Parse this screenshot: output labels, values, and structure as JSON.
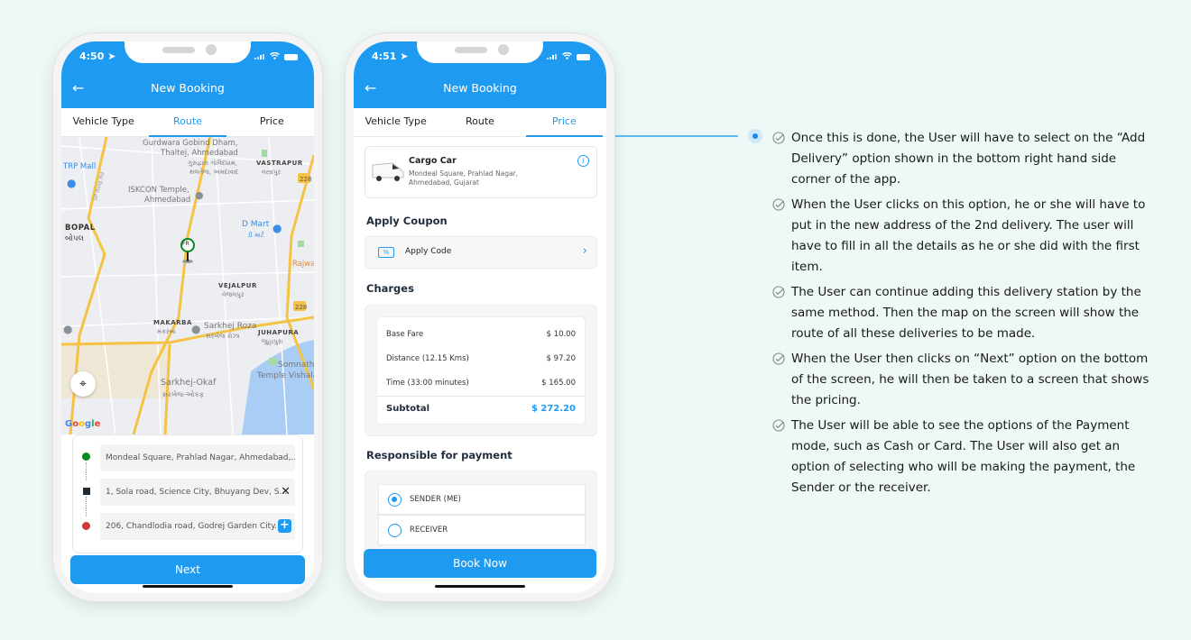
{
  "phone_route": {
    "status_time": "4:50",
    "header_title": "New Booking",
    "tabs": [
      {
        "label": "Vehicle Type",
        "active": false
      },
      {
        "label": "Route",
        "active": true
      },
      {
        "label": "Price",
        "active": false
      }
    ],
    "map": {
      "labels": {
        "gurdwara": "Gurdwara Gobind Dham,",
        "thaltej": "Thaltej, Ahmedabad",
        "gurdwara_gu": "ગુરુદ્વારા ગોવિંદધામ,",
        "thaltej_gu": "થલતેજ, અમદાવાદ",
        "trp": "TRP Mall",
        "vastrapur": "VASTRAPUR",
        "vastrapur_gu": "વસ્ત્રાપુર",
        "iskcon": "ISKCON Temple,",
        "iskcon2": "Ahmedabad",
        "bopal": "BOPAL",
        "bopal_gu": "બોપલ",
        "dmart": "D Mart",
        "dmart_gu": "ડી માર્ટ",
        "rajwa": "Rajwa",
        "vejalpur": "VEJALPUR",
        "vejalpur_gu": "વેજલપુર",
        "makarba": "MAKARBA",
        "makarba_gu": "મકરબા",
        "sarkhej_roza": "Sarkhej Roza",
        "sarkhej_roza_gu": "સરખેજ રોઝા",
        "juhapura": "JUHAPURA",
        "juhapura_gu": "જુહાપુરા",
        "somnath": "Somnath",
        "somnath2": "Temple Vishala",
        "sarkhej_okaf": "Sarkhej-Okaf",
        "sarkhej_okaf_gu": "સરખેજ-ઓકફ",
        "road_228": "228",
        "sp_ring": "SP Ring Rd",
        "google": "Google"
      },
      "pin_label": "FR"
    },
    "route_stops": [
      {
        "address": "Mondeal Square, Prahlad Nagar, Ahmedabad,...",
        "marker": "green-dot",
        "action": ""
      },
      {
        "address": "1, Sola road, Science City, Bhuyang Dev, S...",
        "marker": "square",
        "action": "remove"
      },
      {
        "address": "206, Chandlodia road, Godrej Garden City...",
        "marker": "red-dot",
        "action": "add"
      }
    ],
    "next_label": "Next"
  },
  "phone_price": {
    "status_time": "4:51",
    "header_title": "New Booking",
    "tabs": [
      {
        "label": "Vehicle Type",
        "active": false
      },
      {
        "label": "Route",
        "active": false
      },
      {
        "label": "Price",
        "active": true
      }
    ],
    "vehicle": {
      "name": "Cargo Car",
      "address": "Mondeal Square, Prahlad Nagar, Ahmedabad, Gujarat"
    },
    "coupon_heading": "Apply Coupon",
    "coupon_label": "Apply Code",
    "coupon_tag": "%",
    "charges_heading": "Charges",
    "charges": [
      {
        "label": "Base Fare",
        "amount": "$ 10.00"
      },
      {
        "label": "Distance (12.15 Kms)",
        "amount": "$ 97.20"
      },
      {
        "label": "Time (33:00 minutes)",
        "amount": "$ 165.00"
      }
    ],
    "subtotal": {
      "label": "Subtotal",
      "amount": "$ 272.20"
    },
    "payment_heading": "Responsible for payment",
    "payment_options": [
      {
        "label": "SENDER (ME)",
        "selected": true
      },
      {
        "label": "RECEIVER",
        "selected": false
      }
    ],
    "book_label": "Book Now"
  },
  "notes": [
    "Once this is done, the User will have to select on the “Add Delivery” option shown in the bottom right hand side corner of the app.",
    "When the User clicks on this option, he or she will have to put in the new address of the 2nd delivery. The user will have to fill in all the details as he or she did with the first item.",
    "The User can continue adding this delivery station by the same method. Then the map on the screen will show the route of all these deliveries to be made.",
    "When the User then clicks on “Next” option on the bottom of the screen, he will then be taken to a screen that shows the pricing.",
    "The User will be able to see the options of the Payment mode, such as Cash or Card. The User will also get an option of selecting who will be making the payment, the Sender or the receiver."
  ],
  "colors": {
    "primary": "#1e9bf0",
    "background": "#eef8f6",
    "start_marker": "#0a8a1e",
    "end_marker": "#d63636"
  }
}
